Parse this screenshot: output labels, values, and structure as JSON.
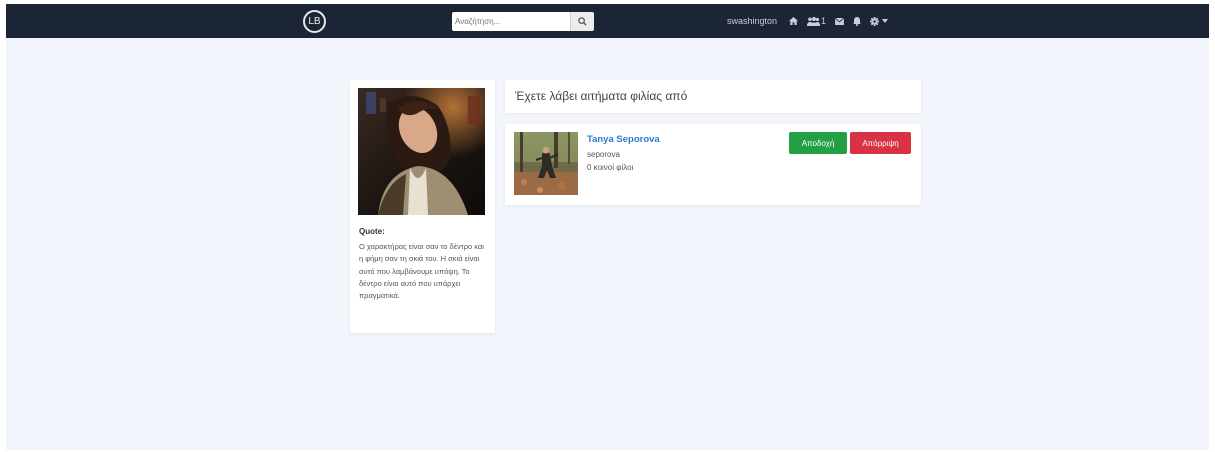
{
  "navbar": {
    "logo_text": "LB",
    "search_placeholder": "Αναζήτηση...",
    "username": "swashington",
    "friend_requests_count": "1",
    "icons": [
      "home-icon",
      "users-icon",
      "envelope-icon",
      "bell-icon",
      "gear-icon",
      "caret-down-icon"
    ]
  },
  "profile": {
    "quote_title": "Quote:",
    "quote_text": "Ο χαρακτήρας είναι σαν το δέντρο και η φήμη σαν τη σκιά του. Η σκιά είναι αυτό που λαμβάνουμε υπόψη. Το δέντρο είναι αυτό που υπάρχει πραγματικά."
  },
  "requests": {
    "header": "Έχετε λάβει αιτήματα φιλίας από",
    "items": [
      {
        "name": "Tanya Seporova",
        "username": "seporova",
        "mutual": "0 κοινοί φίλοι",
        "accept_label": "Αποδοχή",
        "reject_label": "Απόρριψη"
      }
    ]
  },
  "colors": {
    "navbar": "#1c2535",
    "background": "#f2f5fb",
    "accept": "#23a043",
    "reject": "#d93244",
    "link": "#2a7bd6"
  }
}
